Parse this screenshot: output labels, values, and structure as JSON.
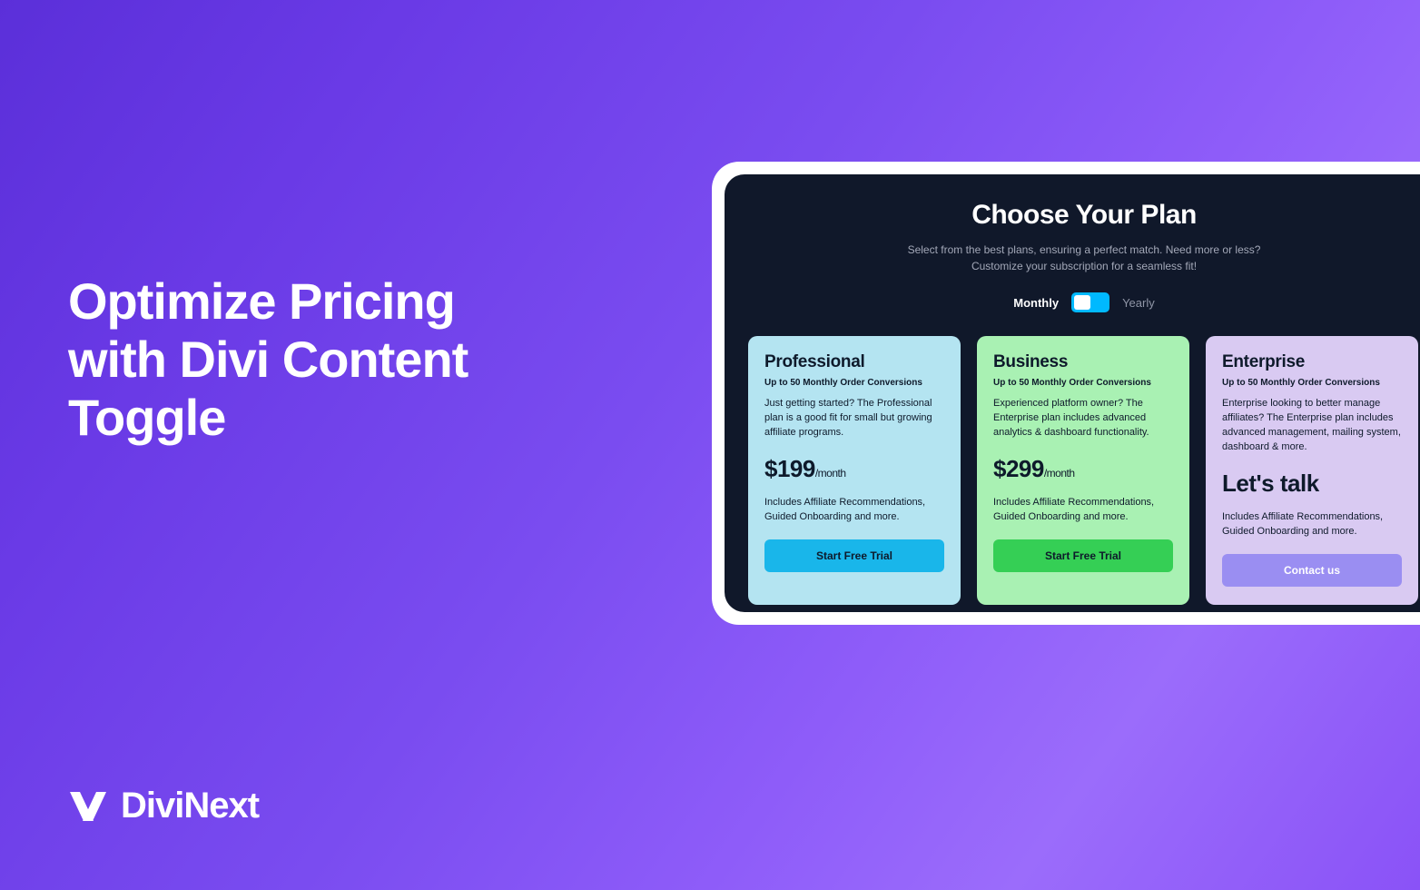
{
  "hero": {
    "title": "Optimize Pricing with Divi Content Toggle"
  },
  "brand": {
    "name": "DiviNext"
  },
  "pricing": {
    "heading": "Choose Your Plan",
    "subheading": "Select from the best plans, ensuring a perfect match. Need more or less? Customize your subscription for a seamless fit!",
    "toggle": {
      "left": "Monthly",
      "right": "Yearly",
      "active": "monthly"
    },
    "plans": [
      {
        "key": "professional",
        "title": "Professional",
        "tagline": "Up to 50 Monthly Order Conversions",
        "description": "Just getting started? The Professional plan is a good fit for small but growing affiliate programs.",
        "price": "$199",
        "period": "/month",
        "includes": "Includes Affiliate Recommendations, Guided Onboarding and more.",
        "cta": "Start Free Trial",
        "card_bg": "#b4e4f1",
        "btn_bg": "#19b6ea"
      },
      {
        "key": "business",
        "title": "Business",
        "tagline": "Up to 50 Monthly Order Conversions",
        "description": "Experienced platform owner? The Enterprise plan includes advanced analytics & dashboard functionality.",
        "price": "$299",
        "period": "/month",
        "includes": "Includes Affiliate Recommendations, Guided Onboarding and more.",
        "cta": "Start Free Trial",
        "card_bg": "#a9f1b3",
        "btn_bg": "#35cf55"
      },
      {
        "key": "enterprise",
        "title": "Enterprise",
        "tagline": "Up to 50 Monthly Order Conversions",
        "description": "Enterprise looking to better manage affiliates? The Enterprise plan includes advanced management, mailing system, dashboard & more.",
        "price": "Let's talk",
        "period": "",
        "includes": "Includes Affiliate Recommendations, Guided Onboarding and more.",
        "cta": "Contact us",
        "card_bg": "#d9caf2",
        "btn_bg": "#9a8ef2"
      }
    ]
  }
}
